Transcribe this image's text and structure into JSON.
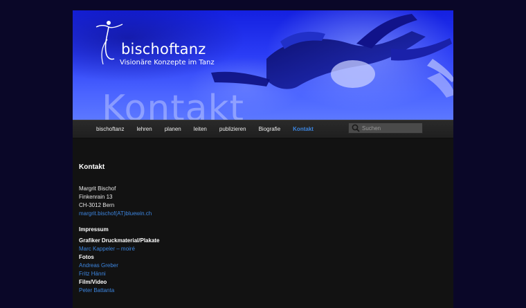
{
  "header": {
    "logo_text": "bischoftanz",
    "tagline": "Visionäre Konzepte im Tanz",
    "page_watermark": "Kontakt",
    "colors": {
      "banner_top": "#1420e0",
      "banner_bottom": "#5c78ff"
    }
  },
  "nav": {
    "items": [
      {
        "label": "bischoftanz",
        "active": false
      },
      {
        "label": "lehren",
        "active": false
      },
      {
        "label": "planen",
        "active": false
      },
      {
        "label": "leiten",
        "active": false
      },
      {
        "label": "publizieren",
        "active": false
      },
      {
        "label": "Biografie",
        "active": false
      },
      {
        "label": "Kontakt",
        "active": true
      }
    ],
    "active_color": "#3d86e0",
    "search": {
      "placeholder": "Suchen",
      "icon": "search-icon"
    }
  },
  "content": {
    "title": "Kontakt",
    "address": {
      "name": "Margrit Bischof",
      "street": "Finkenrain 13",
      "city": "CH-3012 Bern",
      "email": "margrit.bischof(AT)bluewin.ch"
    },
    "impressum_title": "Impressum",
    "credits": [
      {
        "type": "label",
        "text": "Grafiker Druckmaterial/Plakate"
      },
      {
        "type": "link",
        "text": "Marc Kappeler – moiré"
      },
      {
        "type": "label",
        "text": "Fotos"
      },
      {
        "type": "link",
        "text": "Andreas Greber"
      },
      {
        "type": "link",
        "text": "Fritz Hänni"
      },
      {
        "type": "label",
        "text": "Film/Video"
      },
      {
        "type": "link",
        "text": "Peter Battanta"
      }
    ]
  }
}
